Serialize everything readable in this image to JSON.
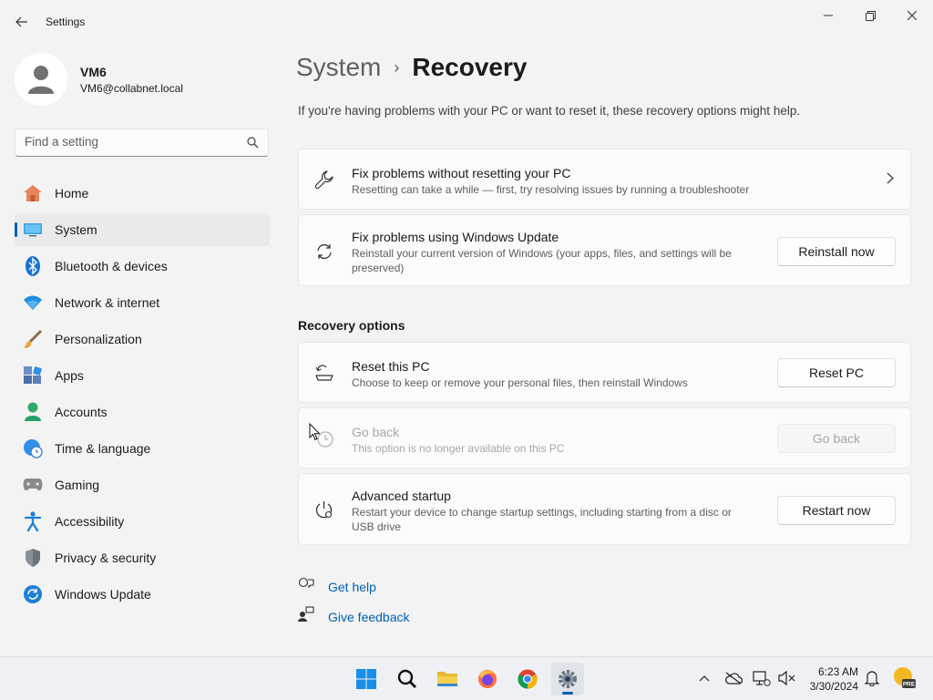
{
  "window": {
    "app_title": "Settings"
  },
  "profile": {
    "name": "VM6",
    "email": "VM6@collabnet.local"
  },
  "search": {
    "placeholder": "Find a setting"
  },
  "nav": [
    {
      "label": "Home",
      "icon": "home-icon"
    },
    {
      "label": "System",
      "icon": "system-icon",
      "selected": true
    },
    {
      "label": "Bluetooth & devices",
      "icon": "bluetooth-icon"
    },
    {
      "label": "Network & internet",
      "icon": "wifi-icon"
    },
    {
      "label": "Personalization",
      "icon": "brush-icon"
    },
    {
      "label": "Apps",
      "icon": "apps-icon"
    },
    {
      "label": "Accounts",
      "icon": "accounts-icon"
    },
    {
      "label": "Time & language",
      "icon": "globe-clock-icon"
    },
    {
      "label": "Gaming",
      "icon": "gamepad-icon"
    },
    {
      "label": "Accessibility",
      "icon": "accessibility-icon"
    },
    {
      "label": "Privacy & security",
      "icon": "shield-icon"
    },
    {
      "label": "Windows Update",
      "icon": "update-icon"
    }
  ],
  "breadcrumb": {
    "parent": "System",
    "separator": "›",
    "current": "Recovery"
  },
  "intro": "If you're having problems with your PC or want to reset it, these recovery options might help.",
  "cards_top": [
    {
      "title": "Fix problems without resetting your PC",
      "desc": "Resetting can take a while — first, try resolving issues by running a troubleshooter"
    },
    {
      "title": "Fix problems using Windows Update",
      "desc": "Reinstall your current version of Windows (your apps, files, and settings will be preserved)",
      "button": "Reinstall now"
    }
  ],
  "recovery_section": {
    "title": "Recovery options",
    "items": [
      {
        "title": "Reset this PC",
        "desc": "Choose to keep or remove your personal files, then reinstall Windows",
        "button": "Reset PC"
      },
      {
        "title": "Go back",
        "desc": "This option is no longer available on this PC",
        "button": "Go back",
        "disabled": true
      },
      {
        "title": "Advanced startup",
        "desc": "Restart your device to change startup settings, including starting from a disc or USB drive",
        "button": "Restart now"
      }
    ]
  },
  "links": {
    "help": "Get help",
    "feedback": "Give feedback"
  },
  "taskbar": {
    "time": "6:23 AM",
    "date": "3/30/2024",
    "badge": "PRE"
  },
  "colors": {
    "accent": "#005fb8",
    "background": "#f3f3f3",
    "card": "#fbfbfb"
  }
}
